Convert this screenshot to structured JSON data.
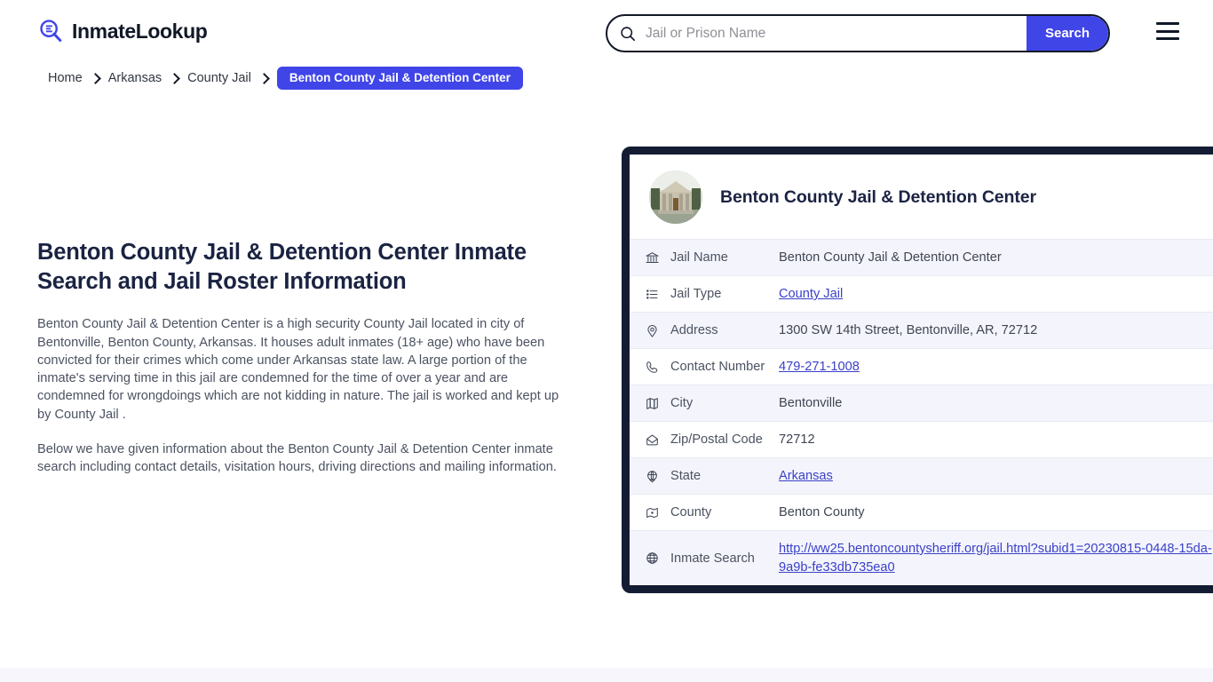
{
  "header": {
    "logo_text": "InmateLookup",
    "logo_icon": "magnifier-list-icon",
    "search": {
      "placeholder": "Jail or Prison Name",
      "value": "",
      "icon": "search-icon",
      "button_label": "Search"
    },
    "menu_icon": "hamburger-menu-icon"
  },
  "breadcrumb": {
    "items": [
      {
        "label": "Home"
      },
      {
        "label": "Arkansas"
      },
      {
        "label": "County Jail"
      }
    ],
    "current": "Benton County Jail & Detention Center"
  },
  "main": {
    "title": "Benton County Jail & Detention Center Inmate Search and Jail Roster Information",
    "paragraphs": [
      "Benton County Jail & Detention Center is a high security County Jail located in city of Bentonville, Benton County, Arkansas. It houses adult inmates (18+ age) who have been convicted for their crimes which come under Arkansas state law. A large portion of the inmate's serving time in this jail are condemned for the time of over a year and are condemned for wrongdoings which are not kidding in nature. The jail is worked and kept up by County Jail .",
      "Below we have given information about the Benton County Jail & Detention Center inmate search including contact details, visitation hours, driving directions and mailing information."
    ]
  },
  "info_card": {
    "avatar_icon": "courthouse-photo",
    "title": "Benton County Jail & Detention Center",
    "rows": [
      {
        "icon": "bank-icon",
        "label": "Jail Name",
        "value": "Benton County Jail & Detention Center",
        "link": false
      },
      {
        "icon": "list-icon",
        "label": "Jail Type",
        "value": "County Jail",
        "link": true
      },
      {
        "icon": "map-pin-icon",
        "label": "Address",
        "value": "1300 SW 14th Street, Bentonville, AR, 72712",
        "link": false
      },
      {
        "icon": "phone-icon",
        "label": "Contact Number",
        "value": "479-271-1008",
        "link": true
      },
      {
        "icon": "map-icon",
        "label": "City",
        "value": "Bentonville",
        "link": false
      },
      {
        "icon": "envelope-icon",
        "label": "Zip/Postal Code",
        "value": "72712",
        "link": false
      },
      {
        "icon": "globe-pin-icon",
        "label": "State",
        "value": "Arkansas",
        "link": true
      },
      {
        "icon": "map-county-icon",
        "label": "County",
        "value": "Benton County",
        "link": false
      },
      {
        "icon": "globe-icon",
        "label": "Inmate Search",
        "value": "http://ww25.bentoncountysheriff.org/jail.html?subid1=20230815-0448-15da-9a9b-fe33db735ea0",
        "link": true
      }
    ]
  },
  "colors": {
    "accent_blue": "#4045e8",
    "link_blue": "#3b40c9",
    "card_border": "#141c34",
    "heading": "#1b2342",
    "row_alt_bg": "#f4f5fc",
    "bottom_band": "#f6f6fc"
  }
}
